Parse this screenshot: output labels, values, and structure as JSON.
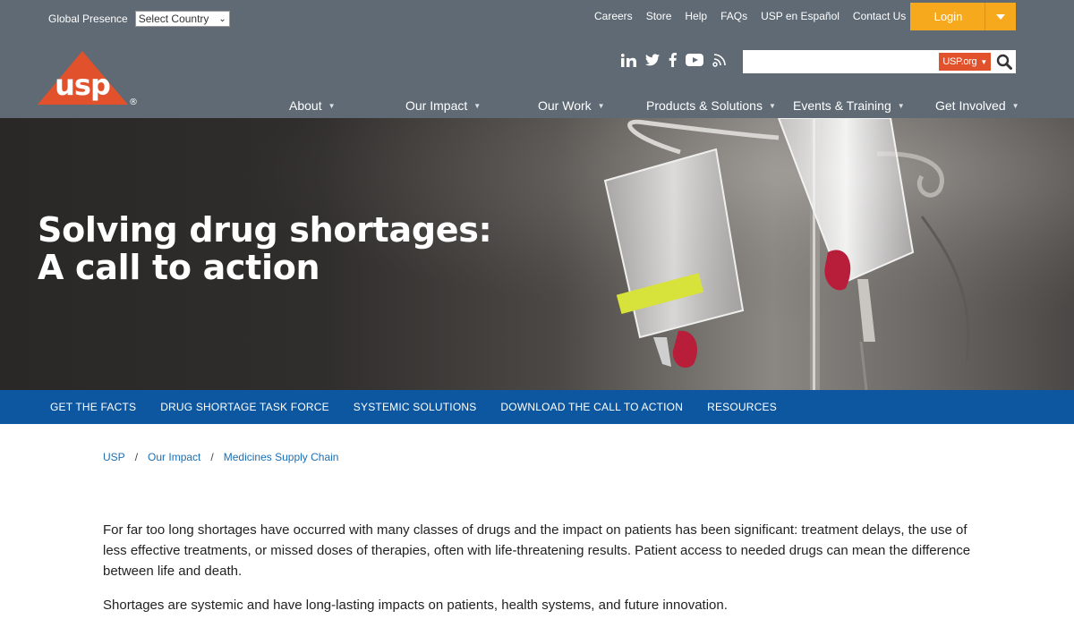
{
  "header": {
    "global_presence_label": "Global Presence",
    "country_select_value": "Select Country",
    "utility_links": [
      "Careers",
      "Store",
      "Help",
      "FAQs",
      "USP en Español",
      "Contact Us"
    ],
    "login_label": "Login",
    "logo_text": "usp",
    "registered_mark": "®",
    "social_icons": [
      "linkedin-icon",
      "twitter-icon",
      "facebook-icon",
      "youtube-icon",
      "rss-icon"
    ],
    "search": {
      "placeholder": "",
      "scope": "USP.org"
    },
    "main_nav": [
      "About",
      "Our Impact",
      "Our Work",
      "Products & Solutions",
      "Events & Training",
      "Get Involved"
    ]
  },
  "hero": {
    "title": "Solving drug shortages: A call to action"
  },
  "subnav": [
    "GET THE FACTS",
    "DRUG SHORTAGE TASK FORCE",
    "SYSTEMIC SOLUTIONS",
    "DOWNLOAD THE CALL TO ACTION",
    "RESOURCES"
  ],
  "breadcrumb": [
    "USP",
    "Our Impact",
    "Medicines Supply Chain"
  ],
  "breadcrumb_separator": "/",
  "content": {
    "paragraphs": [
      "For far too long shortages have occurred with many classes of drugs and the impact on patients has been significant: treatment delays, the use of less effective treatments, or missed doses of therapies, often with life-threatening results. Patient access to needed drugs can mean the difference between life and death.",
      "Shortages are systemic and have long-lasting impacts on patients, health systems, and future innovation."
    ]
  },
  "colors": {
    "header_bg": "#5f6a74",
    "brand_orange": "#e1522c",
    "login_bg": "#f6a91c",
    "subnav_bg": "#0d57a0",
    "link_blue": "#1b6fb5"
  }
}
